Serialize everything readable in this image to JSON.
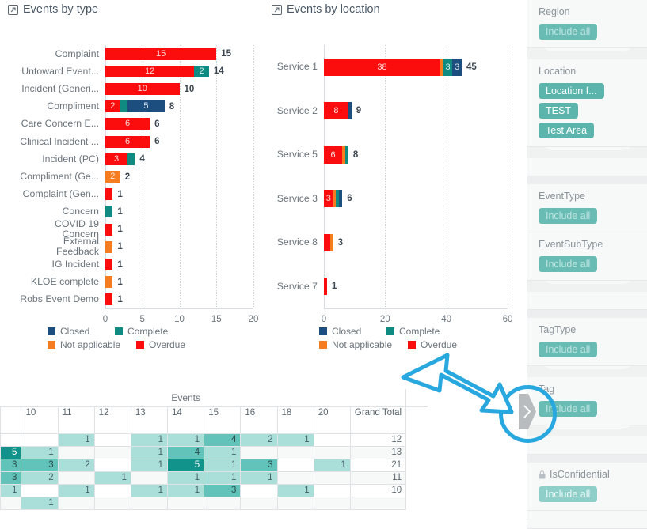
{
  "charts": [
    {
      "id": "events-by-type",
      "title": "Events by type",
      "icon": "popout-icon",
      "axis_ticks": [
        "0",
        "5",
        "10",
        "15",
        "20"
      ],
      "axis_max": 20
    },
    {
      "id": "events-by-location",
      "title": "Events by location",
      "icon": "popout-icon",
      "axis_ticks": [
        "0",
        "20",
        "40",
        "60"
      ],
      "axis_max": 60
    }
  ],
  "legend": {
    "rows": [
      [
        {
          "label": "Closed",
          "color": "#1c4e80"
        },
        {
          "label": "Complete",
          "color": "#0f8b82"
        }
      ],
      [
        {
          "label": "Not applicable",
          "color": "#f57c1f"
        },
        {
          "label": "Overdue",
          "color": "#fb0d0d"
        }
      ]
    ]
  },
  "chart_data": [
    {
      "type": "bar",
      "title": "Events by type",
      "orientation": "horizontal",
      "stacked": true,
      "xlabel": "",
      "ylabel": "",
      "xlim": [
        0,
        20
      ],
      "grid": true,
      "legend_position": "bottom",
      "categories": [
        "Complaint",
        "Untoward Event...",
        "Incident (Generi...",
        "Compliment",
        "Care Concern E...",
        "Clinical Incident ...",
        "Incident (PC)",
        "Compliment (Ge...",
        "Complaint (Gen...",
        "Concern",
        "COVID 19 Concern",
        "External Feedback",
        "IG Incident",
        "KLOE complete",
        "Robs Event Demo"
      ],
      "series": [
        {
          "name": "Overdue",
          "color": "#fb0d0d",
          "values": [
            15,
            12,
            10,
            2,
            6,
            6,
            3,
            0,
            1,
            0,
            1,
            0,
            1,
            0,
            1
          ]
        },
        {
          "name": "Not applicable",
          "color": "#f57c1f",
          "values": [
            0,
            0,
            0,
            0,
            0,
            0,
            0,
            2,
            0,
            0,
            0,
            1,
            0,
            1,
            0
          ]
        },
        {
          "name": "Complete",
          "color": "#0f8b82",
          "values": [
            0,
            2,
            0,
            1,
            0,
            0,
            1,
            0,
            0,
            1,
            0,
            0,
            0,
            0,
            0
          ]
        },
        {
          "name": "Closed",
          "color": "#1c4e80",
          "values": [
            0,
            0,
            0,
            5,
            0,
            0,
            0,
            0,
            0,
            0,
            0,
            0,
            0,
            0,
            0
          ]
        }
      ],
      "totals": [
        15,
        14,
        10,
        8,
        6,
        6,
        4,
        2,
        1,
        1,
        1,
        1,
        1,
        1,
        1
      ]
    },
    {
      "type": "bar",
      "title": "Events by location",
      "orientation": "horizontal",
      "stacked": true,
      "xlabel": "",
      "ylabel": "",
      "xlim": [
        0,
        60
      ],
      "grid": true,
      "legend_position": "bottom",
      "categories": [
        "Service 1",
        "Service 2",
        "Service 5",
        "Service 3",
        "Service 8",
        "Service 7"
      ],
      "series": [
        {
          "name": "Overdue",
          "color": "#fb0d0d",
          "values": [
            38,
            8,
            6,
            3,
            2,
            1
          ]
        },
        {
          "name": "Not applicable",
          "color": "#f57c1f",
          "values": [
            1,
            0,
            1,
            1,
            1,
            0
          ]
        },
        {
          "name": "Complete",
          "color": "#0f8b82",
          "values": [
            3,
            0,
            1,
            1,
            0,
            0
          ]
        },
        {
          "name": "Closed",
          "color": "#1c4e80",
          "values": [
            3,
            1,
            0,
            1,
            0,
            0
          ]
        }
      ],
      "totals": [
        45,
        9,
        8,
        6,
        3,
        1
      ]
    },
    {
      "type": "heatmap",
      "title": "Events",
      "columns": [
        "",
        "10",
        "11",
        "12",
        "13",
        "14",
        "15",
        "16",
        "18",
        "20",
        "Grand Total"
      ],
      "rows": [
        {
          "cells": [
            "",
            "",
            "1",
            "",
            "1",
            "1",
            "4",
            "2",
            "1",
            "",
            "12"
          ]
        },
        {
          "cells": [
            "5",
            "1",
            "",
            "",
            "1",
            "4",
            "1",
            "",
            "",
            "",
            "13"
          ]
        },
        {
          "cells": [
            "3",
            "3",
            "2",
            "",
            "1",
            "5",
            "1",
            "3",
            "",
            "1",
            "21"
          ]
        },
        {
          "cells": [
            "3",
            "2",
            "",
            "1",
            "",
            "1",
            "1",
            "1",
            "",
            "",
            "11"
          ]
        },
        {
          "cells": [
            "1",
            "",
            "1",
            "",
            "1",
            "1",
            "3",
            "",
            "1",
            "",
            "10"
          ]
        },
        {
          "cells": [
            "",
            "1",
            "",
            "",
            "",
            "",
            "",
            "",
            "",
            "",
            ""
          ]
        }
      ]
    }
  ],
  "sidebar": {
    "filters": [
      {
        "name": "Region",
        "chips": [
          {
            "label": "Include all",
            "style": "placeholder"
          }
        ]
      },
      {
        "name": "Location",
        "chips": [
          {
            "label": "Location f...",
            "style": "solid"
          },
          {
            "label": "TEST",
            "style": "solid"
          },
          {
            "label": "Test Area",
            "style": "solid"
          }
        ]
      },
      {
        "name": "EventType",
        "chips": [
          {
            "label": "Include all",
            "style": "placeholder"
          }
        ]
      },
      {
        "name": "EventSubType",
        "chips": [
          {
            "label": "Include all",
            "style": "placeholder"
          }
        ]
      },
      {
        "name": "TagType",
        "chips": [
          {
            "label": "Include all",
            "style": "placeholder"
          }
        ]
      },
      {
        "name": "Tag",
        "chips": [
          {
            "label": "Include all",
            "style": "placeholder"
          }
        ]
      },
      {
        "name": "IsConfidential",
        "locked": true,
        "chips": [
          {
            "label": "Include all",
            "style": "muted"
          }
        ]
      }
    ]
  },
  "annotation": {
    "arrow_color": "#29a8e0",
    "circle_color": "#29a8e0",
    "target": "expand-filter-panel-handle"
  },
  "colors": {
    "overdue": "#fb0d0d",
    "not_applicable": "#f57c1f",
    "complete": "#0f8b82",
    "closed": "#1c4e80",
    "chip_teal": "#5bb5ad",
    "heat_teal": "#0f8b82"
  }
}
